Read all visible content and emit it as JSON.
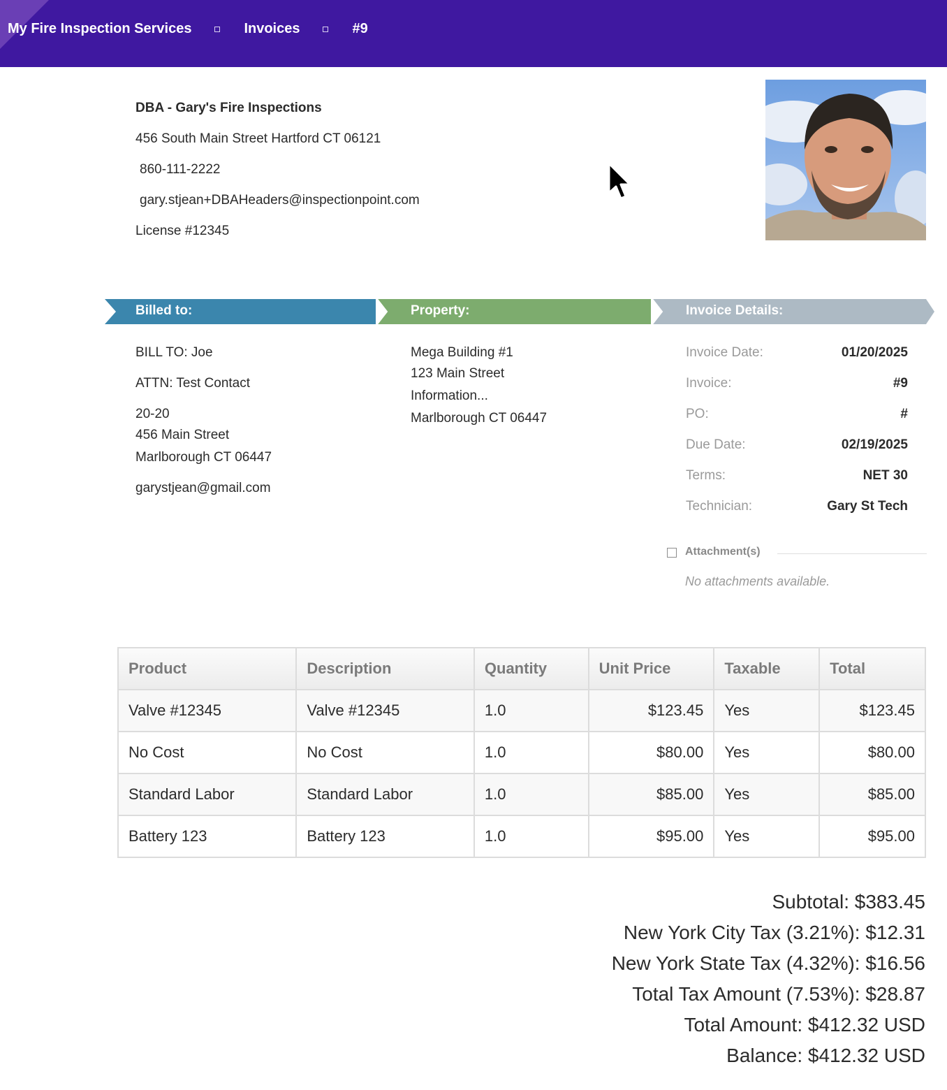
{
  "breadcrumb": {
    "items": [
      "My Fire Inspection Services",
      "Invoices",
      "#9"
    ]
  },
  "company": {
    "name": "DBA - Gary's Fire Inspections",
    "address": "456 South Main Street Hartford CT 06121",
    "phone": "860-111-2222",
    "email": "gary.stjean+DBAHeaders@inspectionpoint.com",
    "license": "License #12345"
  },
  "sections": {
    "billed_to": "Billed to:",
    "property": "Property:",
    "invoice_details": "Invoice Details:"
  },
  "billed_to": {
    "bill_to": "BILL TO: Joe",
    "attn": "ATTN: Test Contact",
    "line1": "20-20",
    "line2": "456 Main Street",
    "line3": "Marlborough CT 06447",
    "email": "garystjean@gmail.com"
  },
  "property": {
    "line1": "Mega Building #1",
    "line2": "123 Main Street",
    "line3": "Information...",
    "line4": "Marlborough CT 06447"
  },
  "details": [
    {
      "label": "Invoice Date:",
      "value": "01/20/2025"
    },
    {
      "label": "Invoice:",
      "value": "#9"
    },
    {
      "label": "PO:",
      "value": "#"
    },
    {
      "label": "Due Date:",
      "value": "02/19/2025"
    },
    {
      "label": "Terms:",
      "value": "NET 30"
    },
    {
      "label": "Technician:",
      "value": "Gary St Tech"
    }
  ],
  "attachments": {
    "title": "Attachment(s)",
    "empty": "No attachments available."
  },
  "table": {
    "headers": [
      "Product",
      "Description",
      "Quantity",
      "Unit Price",
      "Taxable",
      "Total"
    ],
    "rows": [
      [
        "Valve #12345",
        "Valve #12345",
        "1.0",
        "$123.45",
        "Yes",
        "$123.45"
      ],
      [
        "No Cost",
        "No Cost",
        "1.0",
        "$80.00",
        "Yes",
        "$80.00"
      ],
      [
        "Standard Labor",
        "Standard Labor",
        "1.0",
        "$85.00",
        "Yes",
        "$85.00"
      ],
      [
        "Battery 123",
        "Battery 123",
        "1.0",
        "$95.00",
        "Yes",
        "$95.00"
      ]
    ]
  },
  "totals": {
    "subtotal": "Subtotal: $383.45",
    "nyc_tax": "New York City Tax (3.21%): $12.31",
    "nys_tax": "New York State Tax (4.32%): $16.56",
    "total_tax": "Total Tax Amount (7.53%): $28.87",
    "total_amount": "Total Amount: $412.32 USD",
    "balance": "Balance: $412.32 USD"
  },
  "colors": {
    "topbar": "#3f18a0",
    "billed_ribbon": "#3b86ad",
    "property_ribbon": "#7dac6e",
    "details_ribbon": "#adbac4"
  }
}
